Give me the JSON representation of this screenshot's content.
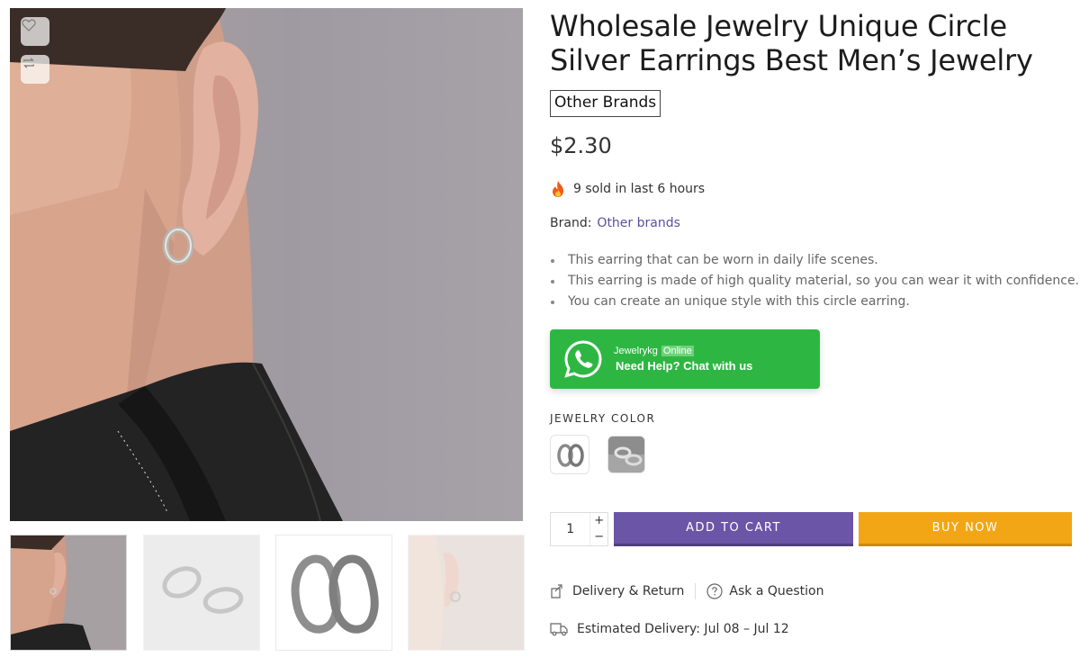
{
  "product": {
    "title": "Wholesale Jewelry Unique Circle Silver Earrings Best Men’s Jewelry",
    "brand_badge": "Other Brands",
    "price": "$2.30",
    "sold_text": "9 sold in last 6 hours",
    "brand_label": "Brand:",
    "brand_link": "Other brands",
    "bullets": [
      "This earring that can be worn in daily life scenes.",
      "This earring is made of high quality material, so you can wear it with confidence.",
      "You can create an unique style with this circle earring."
    ]
  },
  "whatsapp": {
    "name": "Jewelrykg",
    "status": "Online",
    "cta": "Need Help? Chat with us",
    "color": "#2db742"
  },
  "variant": {
    "label": "JEWELRY COLOR"
  },
  "cart": {
    "quantity": "1",
    "plus": "+",
    "minus": "−",
    "add_to_cart": "ADD TO CART",
    "buy_now": "BUY NOW",
    "add_color": "#6b55a6",
    "buy_color": "#f2a616"
  },
  "links": {
    "delivery_return": "Delivery & Return",
    "ask_question": "Ask a Question"
  },
  "delivery": {
    "estimated": "Estimated Delivery: Jul 08 – Jul 12"
  },
  "icons": {
    "wishlist": "heart-icon",
    "compare": "compare-icon",
    "fire": "fire-icon",
    "whatsapp": "whatsapp-icon",
    "delivery": "box-icon",
    "question": "question-icon",
    "truck": "truck-icon"
  }
}
